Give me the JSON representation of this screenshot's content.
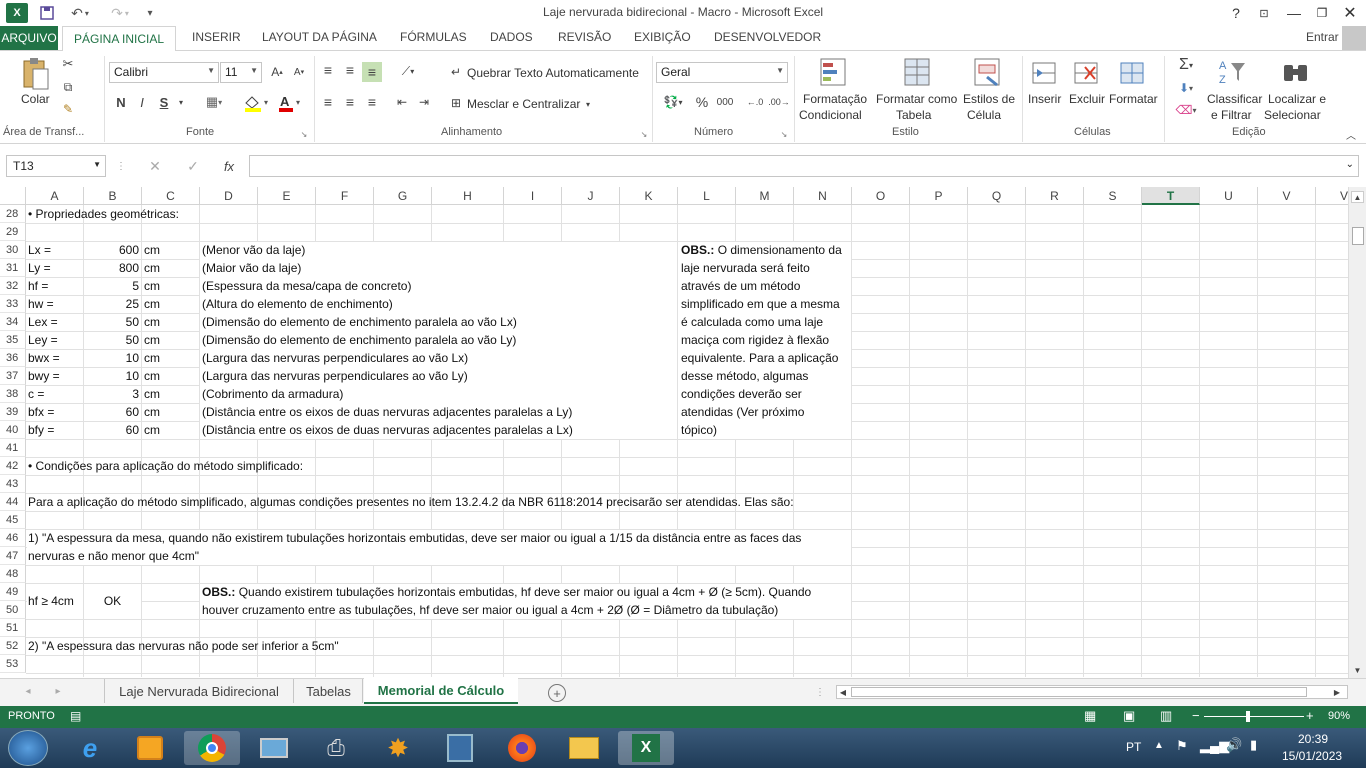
{
  "window": {
    "title": "Laje nervurada bidirecional - Macro - Microsoft Excel",
    "help": "?",
    "signin": "Entrar"
  },
  "tabs": [
    "ARQUIVO",
    "PÁGINA INICIAL",
    "INSERIR",
    "LAYOUT DA PÁGINA",
    "FÓRMULAS",
    "DADOS",
    "REVISÃO",
    "EXIBIÇÃO",
    "DESENVOLVEDOR"
  ],
  "ribbon": {
    "clipboard": {
      "paste": "Colar",
      "group": "Área de Transf..."
    },
    "font": {
      "name": "Calibri",
      "size": "11",
      "bold": "N",
      "italic": "I",
      "underline": "S",
      "group": "Fonte"
    },
    "alignment": {
      "wrap": "Quebrar Texto Automaticamente",
      "merge": "Mesclar e Centralizar",
      "group": "Alinhamento"
    },
    "number": {
      "format": "Geral",
      "percent": "%",
      "thousands": "000",
      "group": "Número"
    },
    "styles": {
      "cond1": "Formatação",
      "cond2": "Condicional",
      "table1": "Formatar como",
      "table2": "Tabela",
      "cell1": "Estilos de",
      "cell2": "Célula",
      "group": "Estilo"
    },
    "cells": {
      "insert": "Inserir",
      "delete": "Excluir",
      "format": "Formatar",
      "group": "Células"
    },
    "editing": {
      "sort1": "Classificar",
      "sort2": "e Filtrar",
      "find1": "Localizar e",
      "find2": "Selecionar",
      "group": "Edição"
    }
  },
  "formula_bar": {
    "name_box": "T13",
    "fx": "fx",
    "value": ""
  },
  "columns": [
    "A",
    "B",
    "C",
    "D",
    "E",
    "F",
    "G",
    "H",
    "I",
    "J",
    "K",
    "L",
    "M",
    "N",
    "O",
    "P",
    "Q",
    "R",
    "S",
    "T",
    "U",
    "V"
  ],
  "rows": [
    "28",
    "29",
    "30",
    "31",
    "32",
    "33",
    "34",
    "35",
    "36",
    "37",
    "38",
    "39",
    "40",
    "41",
    "42",
    "43",
    "44",
    "45",
    "46",
    "47",
    "48",
    "49",
    "50",
    "51",
    "52",
    "53"
  ],
  "content": {
    "r28": "• Propriedades geométricas:",
    "props": [
      {
        "name": "Lx =",
        "value": "600",
        "unit": "cm",
        "desc": "(Menor vão da laje)"
      },
      {
        "name": "Ly =",
        "value": "800",
        "unit": "cm",
        "desc": "(Maior vão da laje)"
      },
      {
        "name": "hf =",
        "value": "5",
        "unit": "cm",
        "desc": "(Espessura da mesa/capa de concreto)"
      },
      {
        "name": "hw =",
        "value": "25",
        "unit": "cm",
        "desc": "(Altura do elemento de enchimento)"
      },
      {
        "name": "Lex =",
        "value": "50",
        "unit": "cm",
        "desc": "(Dimensão do elemento de enchimento paralela ao vão Lx)"
      },
      {
        "name": "Ley =",
        "value": "50",
        "unit": "cm",
        "desc": "(Dimensão do elemento de enchimento paralela ao vão Ly)"
      },
      {
        "name": "bwx =",
        "value": "10",
        "unit": "cm",
        "desc": "(Largura das nervuras perpendiculares ao vão Lx)"
      },
      {
        "name": "bwy =",
        "value": "10",
        "unit": "cm",
        "desc": "(Largura das nervuras perpendiculares ao vão Ly)"
      },
      {
        "name": "c =",
        "value": "3",
        "unit": "cm",
        "desc": "(Cobrimento da armadura)"
      },
      {
        "name": "bfx =",
        "value": "60",
        "unit": "cm",
        "desc": "(Distância entre os eixos de duas nervuras adjacentes paralelas a Ly)"
      },
      {
        "name": "bfy =",
        "value": "60",
        "unit": "cm",
        "desc": "(Distância entre os eixos de duas nervuras adjacentes paralelas a Lx)"
      }
    ],
    "obs_bold": "OBS.:",
    "obs_lines": [
      "O dimensionamento da",
      "laje nervurada será feito",
      "através de um método",
      "simplificado em que a mesma",
      "é calculada como uma laje",
      "maciça com rigidez à flexão",
      "equivalente. Para a aplicação",
      "desse método, algumas",
      "condições deverão ser",
      "atendidas (Ver próximo",
      "tópico)"
    ],
    "r42": "• Condições para aplicação do método simplificado:",
    "r44": "Para a aplicação do método simplificado, algumas condições presentes no item 13.2.4.2 da NBR 6118:2014 precisarão ser atendidas. Elas são:",
    "r46": "1) \"A espessura da mesa, quando não existirem tubulações horizontais embutidas, deve ser maior ou igual a 1/15 da distância entre as faces das",
    "r47": "nervuras e não menor que 4cm\"",
    "r49a": "hf ≥ 4cm",
    "r49b": "OK",
    "obs2_bold": "OBS.:",
    "r49d": "Quando existirem tubulações horizontais embutidas, hf deve ser maior ou igual a 4cm + Ø (≥ 5cm). Quando",
    "r50d": "houver cruzamento entre as tubulações, hf deve ser maior ou igual a 4cm + 2Ø (Ø = Diâmetro da tubulação)",
    "r52": "2) \"A espessura das nervuras não pode ser inferior a 5cm\""
  },
  "sheets": [
    "Laje Nervurada Bidirecional",
    "Tabelas",
    "Memorial de Cálculo"
  ],
  "status": {
    "ready": "PRONTO",
    "zoom": "90%"
  },
  "taskbar": {
    "lang": "PT",
    "time": "20:39",
    "date": "15/01/2023"
  }
}
